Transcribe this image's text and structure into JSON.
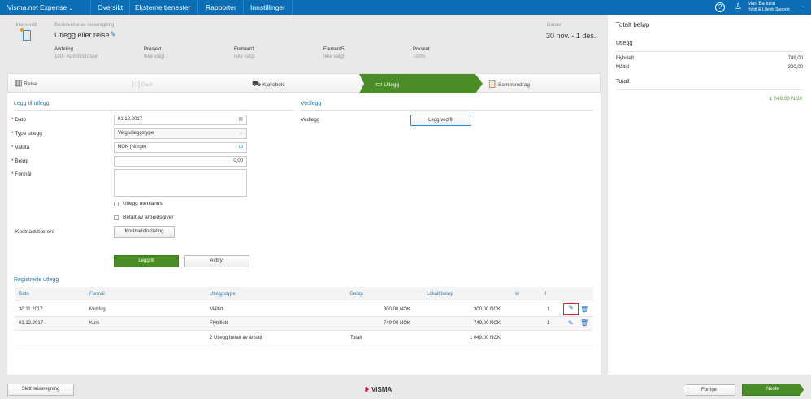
{
  "app": {
    "title": "Visma.net Expense",
    "nav": [
      "Oversikt",
      "Eksterne tjenester",
      "Rapporter",
      "Innstillinger"
    ],
    "user_name": "Mari Barlund",
    "user_company": "Huldt & Lillevik Support"
  },
  "header": {
    "status": "Ikke sendt",
    "desc_label": "Beskrivelse av reiseregning",
    "title": "Utlegg eller reise",
    "dates_label": "Datoer",
    "dates": "30 nov. - 1 des.",
    "fields": [
      {
        "label": "Avdeling",
        "value": "100 - Administrasjon"
      },
      {
        "label": "Prosjekt",
        "value": "Ikke valgt"
      },
      {
        "label": "Element1",
        "value": "Ikke valgt"
      },
      {
        "label": "Element5",
        "value": "Ikke valgt"
      },
      {
        "label": "Prosent",
        "value": "100%"
      }
    ]
  },
  "steps": [
    {
      "label": "Reise"
    },
    {
      "label": "Diett"
    },
    {
      "label": "Kjørebok"
    },
    {
      "label": "Utlegg"
    },
    {
      "label": "Sammendrag"
    }
  ],
  "form": {
    "heading": "Legg til utlegg",
    "dato_label": "Dato",
    "dato": "01.12.2017",
    "type_label": "Type utlegg",
    "type": "Velg utleggstype",
    "valuta_label": "Valuta",
    "valuta": "NOK (Norge)",
    "belop_label": "Beløp",
    "belop": "0,00",
    "formal_label": "Formål",
    "cb1": "Utlegg utenlands",
    "cb2": "Betalt av arbeidsgiver",
    "kost_label": "Kostnadsbærere",
    "kost_btn": "Kostnadsfordeling",
    "add": "Legg til",
    "cancel": "Avbryt"
  },
  "attach": {
    "heading": "Vedlegg",
    "label": "Vedlegg",
    "button": "Legg ved fil"
  },
  "table": {
    "heading": "Registrerte utlegg",
    "columns": [
      "Dato",
      "Formål",
      "Utleggstype",
      "Beløp",
      "Lokalt beløp"
    ],
    "rows": [
      {
        "dato": "30.11.2017",
        "formal": "Middag",
        "type": "Måltid",
        "belop": "300,00 NOK",
        "lokalt": "300,00 NOK",
        "att": "1"
      },
      {
        "dato": "01.12.2017",
        "formal": "Kurs",
        "type": "Flybillett",
        "belop": "749,00 NOK",
        "lokalt": "749,00 NOK",
        "att": "1"
      }
    ],
    "footer_count": "2 Utlegg betalt av ansatt",
    "footer_label": "Totalt",
    "footer_total": "1 049,00 NOK"
  },
  "summary": {
    "title": "Totalt beløp",
    "section": "Utlegg",
    "items": [
      {
        "label": "Flybillett",
        "value": "749,00"
      },
      {
        "label": "Måltid",
        "value": "300,00"
      }
    ],
    "total_label": "Totalt",
    "total": "1 049,00 NOK"
  },
  "footer": {
    "delete": "Slett reiseregning",
    "logo": "VISMA",
    "prev": "Forrige",
    "next": "Neste"
  },
  "colors": {
    "brand": "#0b6db4",
    "accent": "#4a8c26"
  }
}
